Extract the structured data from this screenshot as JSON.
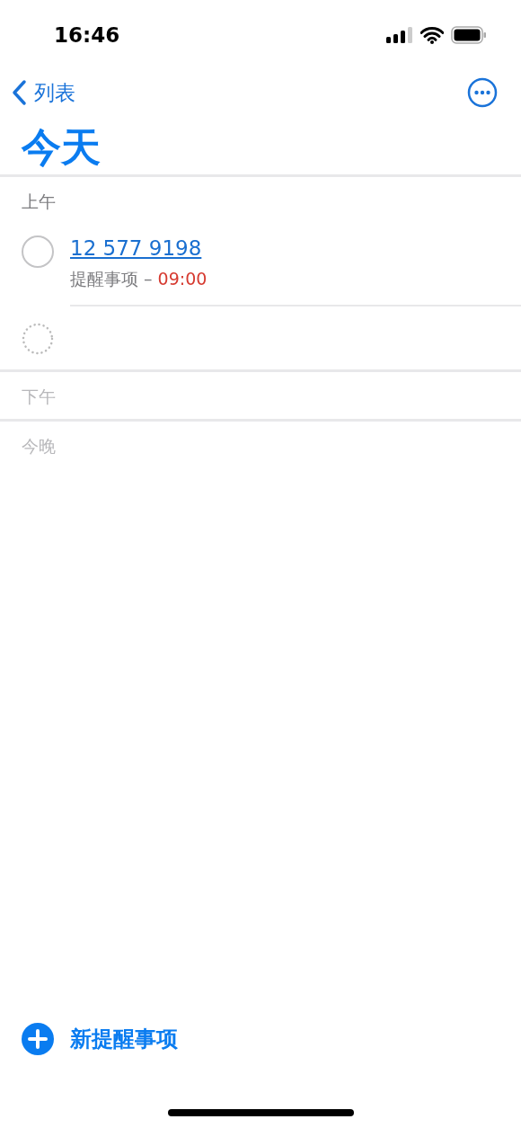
{
  "status_bar": {
    "time": "16:46"
  },
  "nav": {
    "back_label": "列表"
  },
  "title": "今天",
  "sections": [
    {
      "label": "上午",
      "items": [
        {
          "kind": "reminder",
          "title": "12 577 9198",
          "list": "提醒事项 –",
          "time": "09:00",
          "completed": false
        },
        {
          "kind": "placeholder"
        }
      ]
    },
    {
      "label": "下午"
    },
    {
      "label": "今晚"
    }
  ],
  "new_button": {
    "label": "新提醒事项"
  }
}
